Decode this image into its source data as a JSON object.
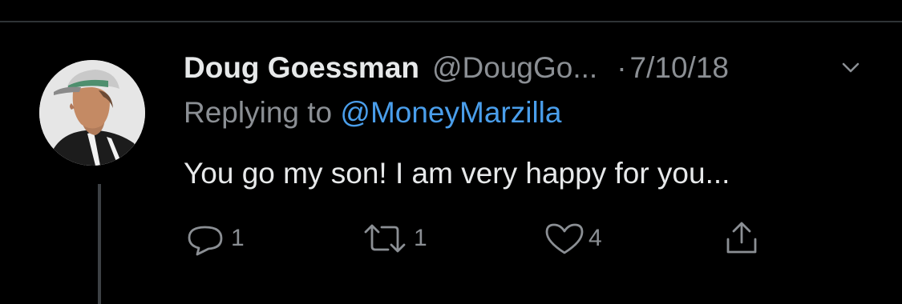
{
  "tweet": {
    "author_name": "Doug Goessman",
    "author_handle": "@DougGo...",
    "separator": "·",
    "date": "7/10/18",
    "reply_prefix": "Replying to",
    "reply_to": "@MoneyMarzilla",
    "text": "You go my son! I am very happy for you...",
    "avatar_alt": "profile photo of man in baseball cap"
  },
  "actions": {
    "reply_count": "1",
    "retweet_count": "1",
    "like_count": "4"
  },
  "icons": {
    "reply": "reply-icon",
    "retweet": "retweet-icon",
    "like": "heart-icon",
    "share": "share-icon",
    "menu": "chevron-down-icon"
  },
  "colors": {
    "background": "#000000",
    "text": "#e7e9ea",
    "secondary": "#8b8f94",
    "mention": "#4a9eeb"
  }
}
